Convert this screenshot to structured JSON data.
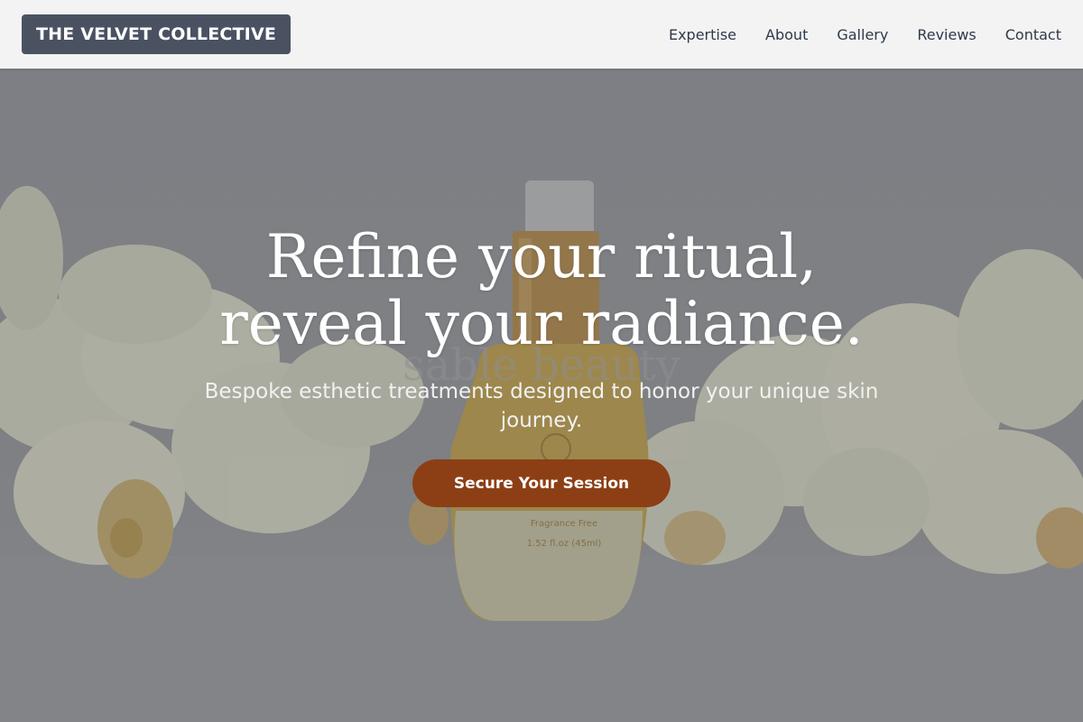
{
  "brand": {
    "name": "THE VELVET COLLECTIVE"
  },
  "nav": {
    "items": [
      {
        "label": "Expertise"
      },
      {
        "label": "About"
      },
      {
        "label": "Gallery"
      },
      {
        "label": "Reviews"
      },
      {
        "label": "Contact"
      }
    ]
  },
  "hero": {
    "headline": "Refine your ritual, reveal your radiance.",
    "subheadline": "Bespoke esthetic treatments designed to honor your unique skin journey.",
    "cta_label": "Secure Your Session",
    "background_text": {
      "watermark": "sable beauty",
      "label_line1": "Fragrance Free",
      "label_line2": "1.52 fl.oz (45ml)"
    }
  },
  "colors": {
    "header_bg": "#f3f3f3",
    "logo_bg": "#4a5262",
    "nav_text": "#2f3a4a",
    "cta_bg": "#8c3f15",
    "hero_overlay": "#85878b"
  }
}
